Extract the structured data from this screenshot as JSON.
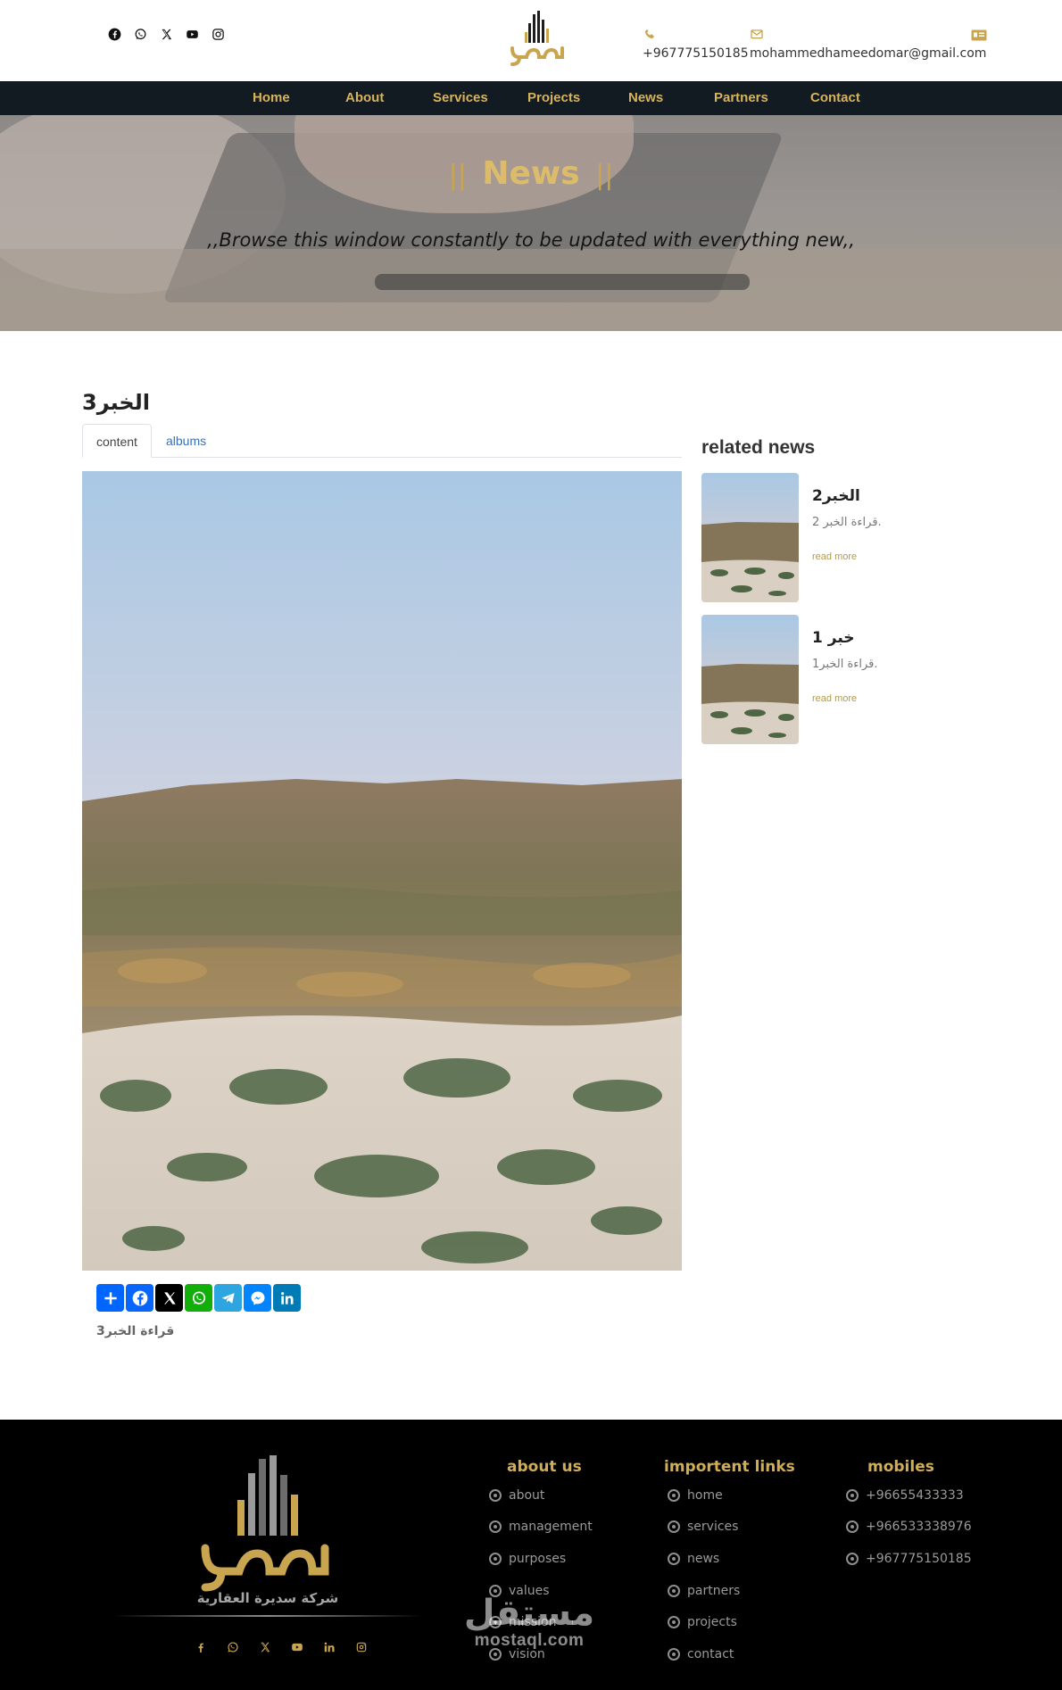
{
  "header": {
    "social_icons": [
      "facebook-icon",
      "whatsapp-icon",
      "x-icon",
      "youtube-icon",
      "instagram-icon"
    ],
    "phone": "+967775150185",
    "email": "mohammedhameedomar@gmail.com",
    "brand_color": "#c9a550"
  },
  "nav": {
    "items": [
      "Home",
      "About",
      "Services",
      "Projects",
      "News",
      "Partners",
      "Contact"
    ]
  },
  "hero": {
    "title": "News",
    "subtitle": ",,Browse this window constantly to be updated with everything new,,"
  },
  "article": {
    "title": "الخبر3",
    "tabs": [
      "content",
      "albums"
    ],
    "active_tab": "content",
    "caption": "قراءة الخبر3"
  },
  "share": {
    "buttons": [
      {
        "icon": "share-plus-icon",
        "color": "#0166ff"
      },
      {
        "icon": "facebook-icon",
        "color": "#0866ff"
      },
      {
        "icon": "x-icon",
        "color": "#000000"
      },
      {
        "icon": "whatsapp-icon",
        "color": "#12af0a"
      },
      {
        "icon": "telegram-icon",
        "color": "#2ca5e0"
      },
      {
        "icon": "messenger-icon",
        "color": "#0084ff"
      },
      {
        "icon": "linkedin-icon",
        "color": "#007bb5"
      }
    ]
  },
  "sidebar": {
    "title": "related news",
    "items": [
      {
        "title": "الخبر2",
        "excerpt": "قراءة الخبر 2.",
        "more": "read more"
      },
      {
        "title": "خبر 1",
        "excerpt": "قراءة الخبر1.",
        "more": "read more"
      }
    ]
  },
  "footer": {
    "logo_caption": "شركة سديرة العقارية",
    "social_icons": [
      "facebook-icon",
      "whatsapp-icon",
      "x-icon",
      "youtube-icon",
      "linkedin-icon",
      "instagram-icon"
    ],
    "about": {
      "title": "about us",
      "links": [
        "about",
        "management",
        "purposes",
        "values",
        "mission",
        "vision"
      ]
    },
    "important": {
      "title": "importent links",
      "links": [
        "home",
        "services",
        "news",
        "partners",
        "projects",
        "contact"
      ]
    },
    "mobiles": {
      "title": "mobiles",
      "numbers": [
        "+96655433333",
        "+966533338976",
        "+967775150185"
      ]
    },
    "watermark_ar": "مستقل",
    "watermark_en": "mostaql.com"
  }
}
